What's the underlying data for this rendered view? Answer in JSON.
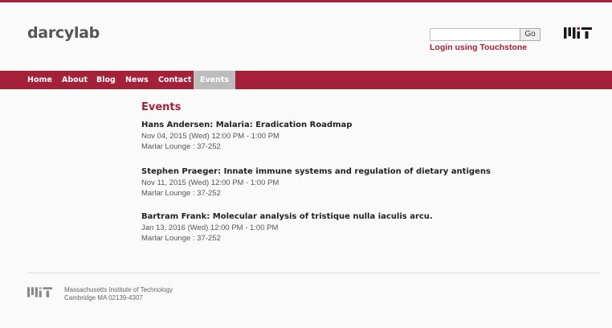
{
  "header": {
    "site_title": "darcylab",
    "search": {
      "value": "",
      "placeholder": "",
      "button_label": "Go"
    },
    "login_label": "Login using Touchstone",
    "logo_icon": "mit-logo-icon"
  },
  "nav": {
    "items": [
      {
        "label": "Home"
      },
      {
        "label": "About"
      },
      {
        "label": "Blog"
      },
      {
        "label": "News"
      },
      {
        "label": "Contact"
      },
      {
        "label": "Events"
      }
    ],
    "active": "Events"
  },
  "main": {
    "heading": "Events",
    "events": [
      {
        "title": "Hans Andersen: Malaria: Eradication Roadmap",
        "date": "Nov 04, 2015 (Wed)  12:00 PM - 1:00 PM",
        "location": "Marlar Lounge : 37-252"
      },
      {
        "title": "Stephen Praeger: Innate immune systems and regulation of dietary antigens",
        "date": "Nov 11, 2015 (Wed)  12:00 PM - 1:00 PM",
        "location": "Marlar Lounge : 37-252"
      },
      {
        "title": "Bartram Frank: Molecular analysis of tristique nulla iaculis arcu.",
        "date": "Jan 13, 2016 (Wed)  12:00 PM - 1:00 PM",
        "location": "Marlar Lounge : 37-252"
      }
    ]
  },
  "footer": {
    "line1": "Massachusetts Institute of Technology",
    "line2": "Cambridge MA 02139-4307"
  },
  "colors": {
    "accent": "#a5213a",
    "active_tab": "#bcbcbc",
    "text": "#222222"
  }
}
